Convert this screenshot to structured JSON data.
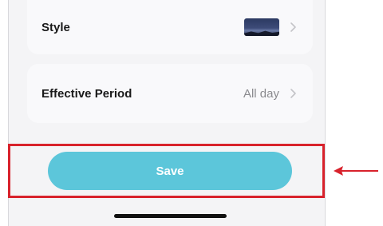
{
  "settings": {
    "style": {
      "label": "Style",
      "thumbnail_icon": "night-landscape-thumbnail"
    },
    "effective_period": {
      "label": "Effective Period",
      "value": "All day"
    }
  },
  "actions": {
    "save_label": "Save"
  },
  "colors": {
    "save_button": "#5cc6da",
    "highlight_box": "#d8222c",
    "annotation_arrow": "#d8222c"
  },
  "icons": {
    "chevron": "chevron-right-icon",
    "arrow": "arrow-left-icon"
  }
}
